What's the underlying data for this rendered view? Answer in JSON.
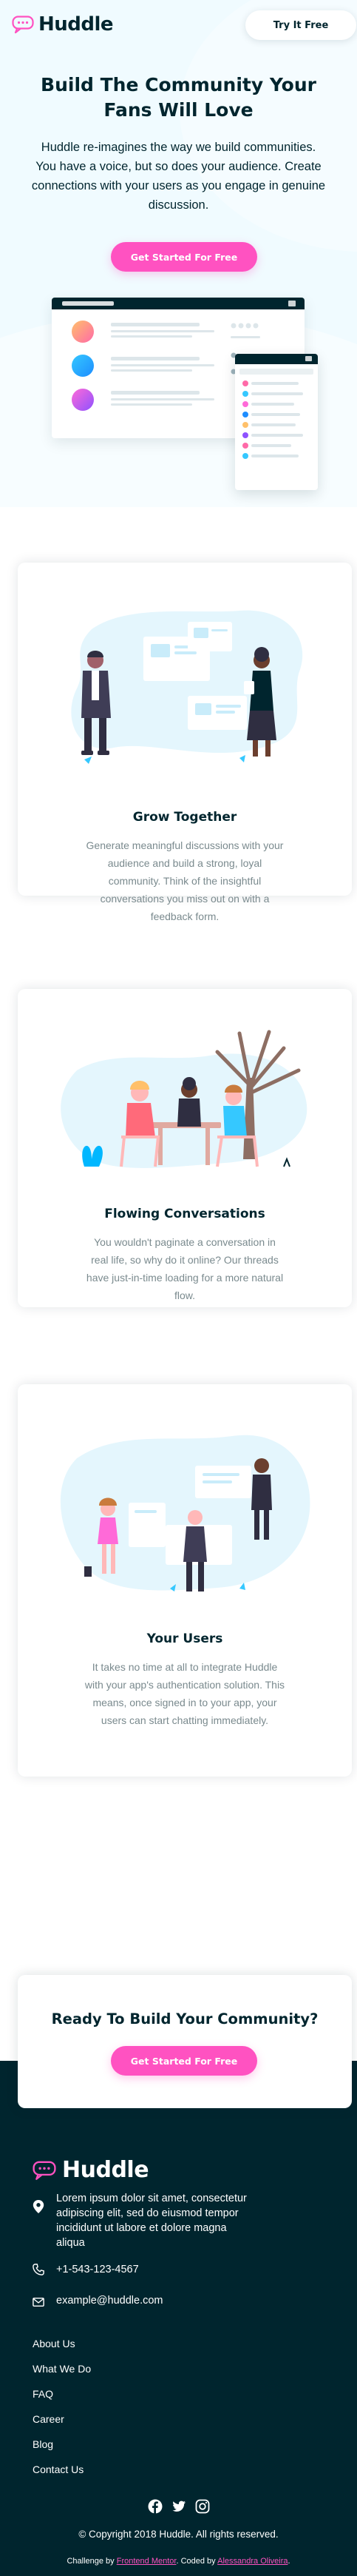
{
  "colors": {
    "pink": "#ff52c1",
    "dark_cyan": "#00252e",
    "pale_blue": "#f0fbff",
    "gray_text": "#7a8a8e"
  },
  "nav": {
    "logo_text": "Huddle",
    "try_button": "Try It Free"
  },
  "hero": {
    "title": "Build The Community Your Fans Will Love",
    "text": "Huddle re-imagines the way we build communities. You have a voice, but so does your audience. Create connections with your users as you engage in genuine discussion.",
    "cta": "Get Started For Free"
  },
  "features": [
    {
      "title": "Grow Together",
      "text": "Generate meaningful discussions with your audience and build a strong, loyal community. Think of the insightful conversations you miss out on with a feedback form."
    },
    {
      "title": "Flowing Conversations",
      "text": "You wouldn't paginate a conversation in real life, so why do it online? Our threads have just-in-time loading for a more natural flow."
    },
    {
      "title": "Your Users",
      "text": "It takes no time at all to integrate Huddle with your app's authentication solution. This means, once signed in to your app, your users can start chatting immediately."
    }
  ],
  "cta_section": {
    "title": "Ready To Build Your Community?",
    "button": "Get Started For Free"
  },
  "footer": {
    "logo_text": "Huddle",
    "address": "Lorem ipsum dolor sit amet, consectetur adipiscing elit, sed do eiusmod tempor incididunt ut labore et dolore magna aliqua",
    "phone": "+1-543-123-4567",
    "email": "example@huddle.com",
    "links": [
      "About Us",
      "What We Do",
      "FAQ",
      "Career",
      "Blog",
      "Contact Us"
    ],
    "socials": [
      "facebook-icon",
      "twitter-icon",
      "instagram-icon"
    ],
    "copyright": "© Copyright 2018 Huddle. All rights reserved.",
    "credit_prefix": "Challenge by",
    "credit_fm": "Frontend Mentor",
    "credit_mid": ". Coded by",
    "credit_author": "Alessandra Oliveira",
    "credit_suffix": "."
  }
}
